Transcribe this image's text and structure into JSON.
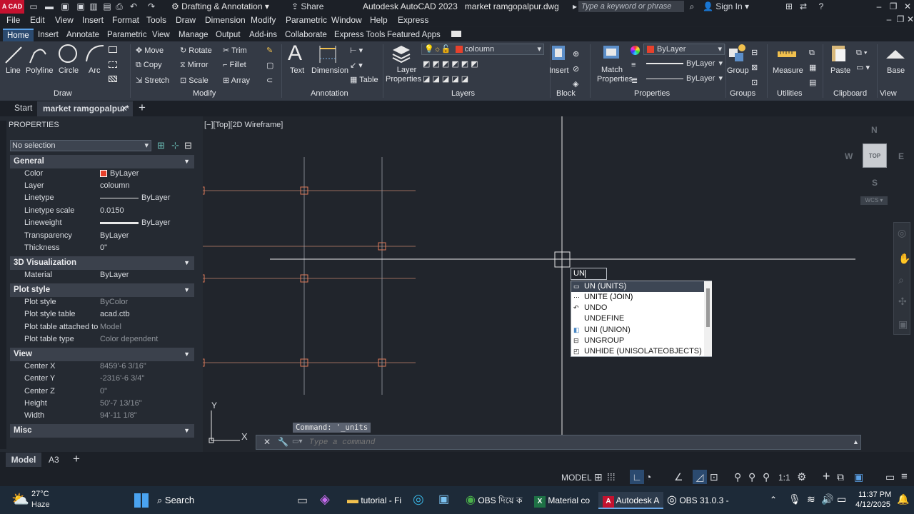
{
  "titlebar": {
    "workspace": "Drafting & Annotation",
    "share": "Share",
    "app_title": "Autodesk AutoCAD 2023",
    "file_title": "market ramgopalpur.dwg",
    "search_placeholder": "Type a keyword or phrase",
    "signin": "Sign In",
    "logo": "A CAD"
  },
  "menu": [
    "File",
    "Edit",
    "View",
    "Insert",
    "Format",
    "Tools",
    "Draw",
    "Dimension",
    "Modify",
    "Parametric",
    "Window",
    "Help",
    "Express"
  ],
  "ribbon_tabs": [
    "Home",
    "Insert",
    "Annotate",
    "Parametric",
    "View",
    "Manage",
    "Output",
    "Add-ins",
    "Collaborate",
    "Express Tools",
    "Featured Apps"
  ],
  "ribbon": {
    "draw": {
      "line": "Line",
      "polyline": "Polyline",
      "circle": "Circle",
      "arc": "Arc",
      "title": "Draw"
    },
    "modify": {
      "move": "Move",
      "rotate": "Rotate",
      "trim": "Trim",
      "copy": "Copy",
      "mirror": "Mirror",
      "fillet": "Fillet",
      "stretch": "Stretch",
      "scale": "Scale",
      "array": "Array",
      "title": "Modify"
    },
    "annotation": {
      "text": "Text",
      "dimension": "Dimension",
      "table": "Table",
      "title": "Annotation"
    },
    "layers": {
      "properties_1": "Layer",
      "properties_2": "Properties",
      "current": "coloumn",
      "title": "Layers"
    },
    "block": {
      "insert": "Insert",
      "title": "Block"
    },
    "properties": {
      "match_1": "Match",
      "match_2": "Properties",
      "color": "ByLayer",
      "linetype": "ByLayer",
      "lineweight": "ByLayer",
      "title": "Properties"
    },
    "groups": {
      "group": "Group",
      "title": "Groups"
    },
    "utilities": {
      "measure": "Measure",
      "title": "Utilities"
    },
    "clipboard": {
      "paste": "Paste",
      "title": "Clipboard"
    },
    "view": {
      "base": "Base",
      "title": "View"
    }
  },
  "doc_tabs": {
    "start": "Start",
    "active": "market ramgopalpur*"
  },
  "properties_panel": {
    "title": "PROPERTIES",
    "selection": "No selection",
    "general": {
      "title": "General",
      "rows": [
        {
          "k": "Color",
          "v": "ByLayer"
        },
        {
          "k": "Layer",
          "v": "coloumn"
        },
        {
          "k": "Linetype",
          "v": "ByLayer"
        },
        {
          "k": "Linetype scale",
          "v": "0.0150"
        },
        {
          "k": "Lineweight",
          "v": "ByLayer"
        },
        {
          "k": "Transparency",
          "v": "ByLayer"
        },
        {
          "k": "Thickness",
          "v": "0\""
        }
      ]
    },
    "viz": {
      "title": "3D Visualization",
      "rows": [
        {
          "k": "Material",
          "v": "ByLayer"
        }
      ]
    },
    "plot": {
      "title": "Plot style",
      "rows": [
        {
          "k": "Plot style",
          "v": "ByColor"
        },
        {
          "k": "Plot style table",
          "v": "acad.ctb"
        },
        {
          "k": "Plot table attached to",
          "v": "Model"
        },
        {
          "k": "Plot table type",
          "v": "Color dependent"
        }
      ]
    },
    "view": {
      "title": "View",
      "rows": [
        {
          "k": "Center X",
          "v": "8459'-6 3/16\""
        },
        {
          "k": "Center Y",
          "v": "-2316'-6 3/4\""
        },
        {
          "k": "Center Z",
          "v": "0\""
        },
        {
          "k": "Height",
          "v": "50'-7 13/16\""
        },
        {
          "k": "Width",
          "v": "94'-11 1/8\""
        }
      ]
    },
    "misc": {
      "title": "Misc"
    }
  },
  "viewport_label": "[−][Top][2D Wireframe]",
  "viewcube": {
    "n": "N",
    "s": "S",
    "e": "E",
    "w": "W",
    "top": "TOP",
    "wcs": "WCS"
  },
  "ucs": {
    "x": "X",
    "y": "Y"
  },
  "dynamic_input": "UN",
  "autocomplete": [
    "UN (UNITS)",
    "UNITE (JOIN)",
    "UNDO",
    "UNDEFINE",
    "UNI (UNION)",
    "UNGROUP",
    "UNHIDE (UNISOLATEOBJECTS)"
  ],
  "command": {
    "history": "Command: '_units",
    "placeholder": "Type a command"
  },
  "layout_tabs": [
    "Model",
    "A3"
  ],
  "status": {
    "model": "MODEL",
    "scale": "1:1"
  },
  "taskbar": {
    "weather_temp": "27°C",
    "weather_desc": "Haze",
    "search": "Search",
    "apps": [
      "tutorial - Fi",
      "OBS দিয়ে ক",
      "Material co",
      "Autodesk A",
      "OBS 31.0.3 -"
    ],
    "time": "11:37 PM",
    "date": "4/12/2025"
  }
}
